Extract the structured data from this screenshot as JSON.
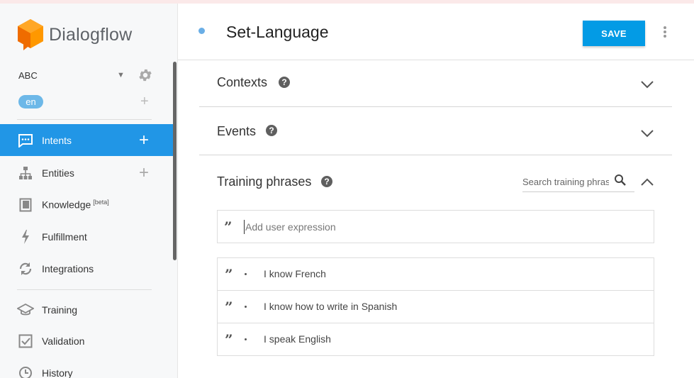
{
  "app": {
    "name": "Dialogflow"
  },
  "agent": {
    "name": "ABC",
    "language": "en"
  },
  "sidebar": {
    "items": [
      {
        "label": "Intents",
        "icon": "chat-bubble-icon",
        "active": true,
        "has_add": true
      },
      {
        "label": "Entities",
        "icon": "hierarchy-icon",
        "active": false,
        "has_add": true
      },
      {
        "label": "Knowledge",
        "badge": "[beta]",
        "icon": "book-icon",
        "active": false,
        "has_add": false
      },
      {
        "label": "Fulfillment",
        "icon": "bolt-icon",
        "active": false,
        "has_add": false
      },
      {
        "label": "Integrations",
        "icon": "sync-icon",
        "active": false,
        "has_add": false
      },
      {
        "label": "Training",
        "icon": "graduation-cap-icon",
        "active": false,
        "has_add": false
      },
      {
        "label": "Validation",
        "icon": "checkbox-icon",
        "active": false,
        "has_add": false
      },
      {
        "label": "History",
        "icon": "clock-icon",
        "active": false,
        "has_add": false
      }
    ]
  },
  "header": {
    "title": "Set-Language",
    "save_label": "SAVE"
  },
  "sections": {
    "contexts": {
      "title": "Contexts"
    },
    "events": {
      "title": "Events"
    },
    "training": {
      "title": "Training phrases",
      "search_placeholder": "Search training phrases",
      "add_placeholder": "Add user expression",
      "phrases": [
        "I know French",
        "I know how to write in Spanish",
        "I speak English"
      ]
    }
  },
  "colors": {
    "accent": "#2196e6",
    "save_button": "#039be5",
    "logo_orange": "#f57c00"
  }
}
